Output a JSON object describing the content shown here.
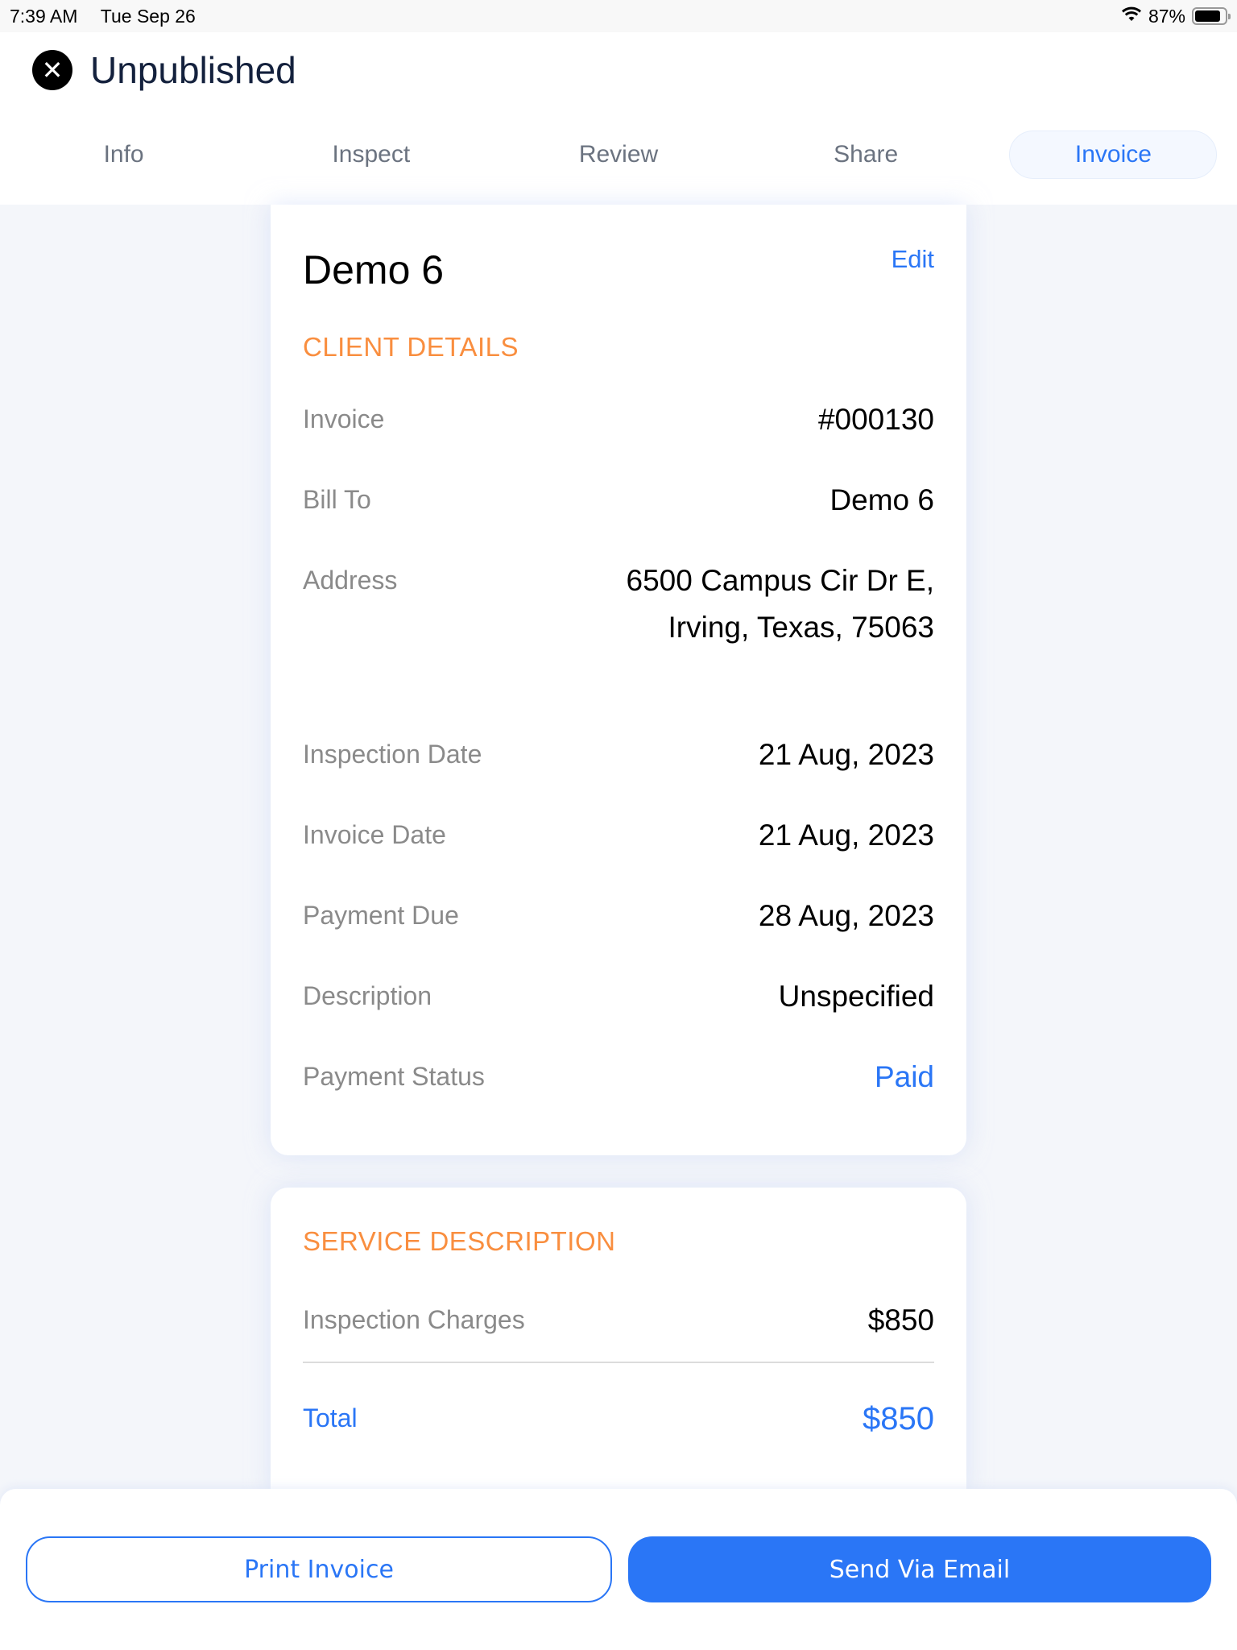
{
  "status_bar": {
    "time": "7:39 AM",
    "date": "Tue Sep 26",
    "wifi_icon": "wifi-icon",
    "battery_percent": "87%",
    "battery_level": 0.87
  },
  "header": {
    "close_icon": "close-circle-icon",
    "title": "Unpublished"
  },
  "tabs": [
    {
      "label": "Info",
      "active": false
    },
    {
      "label": "Inspect",
      "active": false
    },
    {
      "label": "Review",
      "active": false
    },
    {
      "label": "Share",
      "active": false
    },
    {
      "label": "Invoice",
      "active": true
    }
  ],
  "invoice": {
    "client_name": "Demo 6",
    "edit_label": "Edit",
    "client_section_title": "CLIENT DETAILS",
    "details": [
      {
        "label": "Invoice",
        "value": "#000130"
      },
      {
        "label": "Bill To",
        "value": "Demo 6"
      },
      {
        "label": "Address",
        "value": "6500 Campus Cir Dr E, Irving, Texas, 75063"
      },
      {
        "label": "Inspection Date",
        "value": "21 Aug, 2023"
      },
      {
        "label": "Invoice Date",
        "value": "21 Aug, 2023"
      },
      {
        "label": "Payment Due",
        "value": "28 Aug, 2023"
      },
      {
        "label": "Description",
        "value": "Unspecified"
      },
      {
        "label": "Payment Status",
        "value": "Paid"
      }
    ],
    "service_section_title": "SERVICE DESCRIPTION",
    "services": [
      {
        "label": "Inspection Charges",
        "value": "$850"
      }
    ],
    "total_label": "Total",
    "total_value": "$850"
  },
  "footer": {
    "print_label": "Print Invoice",
    "email_label": "Send Via Email"
  },
  "colors": {
    "accent_blue": "#2a76f6",
    "section_orange": "#f98e3f",
    "title_navy": "#14213d"
  }
}
